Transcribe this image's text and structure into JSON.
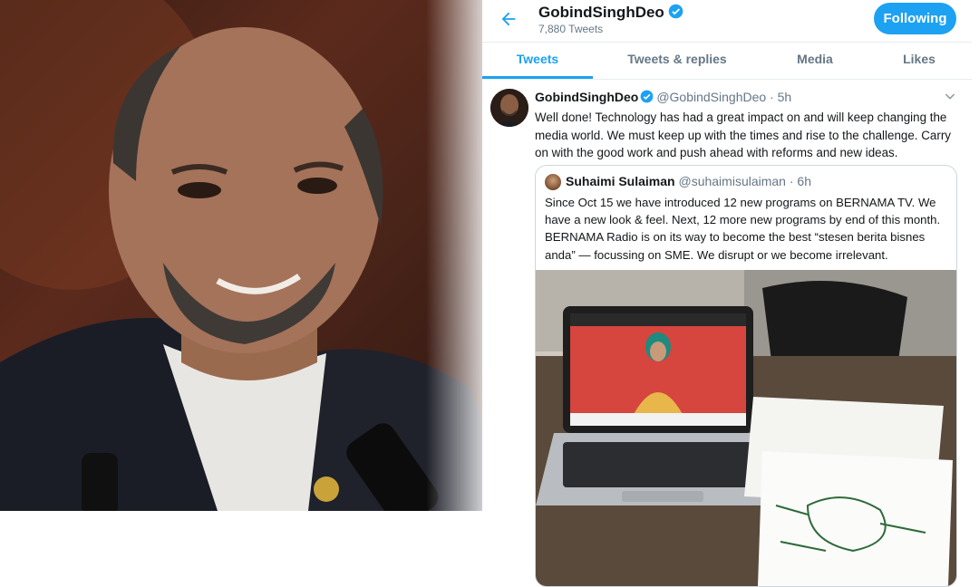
{
  "header": {
    "name": "GobindSinghDeo",
    "tweet_count": "7,880 Tweets",
    "follow_label": "Following"
  },
  "tabs": [
    {
      "label": "Tweets",
      "active": true
    },
    {
      "label": "Tweets & replies",
      "active": false
    },
    {
      "label": "Media",
      "active": false
    },
    {
      "label": "Likes",
      "active": false
    }
  ],
  "tweet": {
    "name": "GobindSinghDeo",
    "handle": "@GobindSinghDeo",
    "time": "· 5h",
    "text": "Well done! Technology has had a great impact on and will keep changing the media world. We must keep up with the times and rise to the challenge. Carry on with the good work and push ahead with reforms and new ideas."
  },
  "quote": {
    "name": "Suhaimi Sulaiman",
    "handle": "@suhaimisulaiman",
    "time": "· 6h",
    "text": "Since Oct 15 we have introduced 12 new programs on BERNAMA TV.  We have a new look & feel.  Next, 12 more new programs by end of this month.  BERNAMA Radio is on its way to become the best “stesen berita bisnes anda” — focussing on SME. We disrupt or we become irrelevant."
  },
  "icons": {
    "back": "arrow-left-icon",
    "verified": "verified-badge-icon",
    "caret": "chevron-down-icon"
  },
  "colors": {
    "accent": "#1da1f2",
    "text": "#14171a",
    "muted": "#657786",
    "border": "#e6ecf0"
  }
}
